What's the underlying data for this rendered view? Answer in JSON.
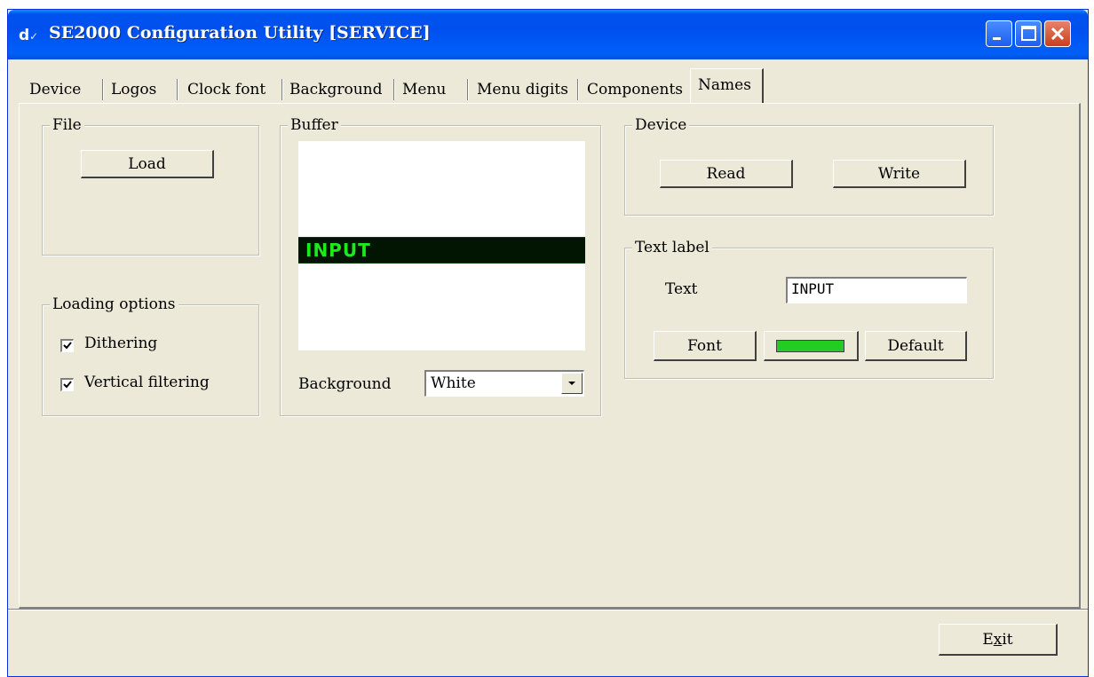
{
  "window": {
    "title": "SE2000 Configuration Utility [SERVICE]",
    "icon_text": "d",
    "icon_tick": "✓"
  },
  "tabs": [
    {
      "label": "Device"
    },
    {
      "label": "Logos"
    },
    {
      "label": "Clock font"
    },
    {
      "label": "Background"
    },
    {
      "label": "Menu"
    },
    {
      "label": "Menu digits"
    },
    {
      "label": "Components"
    },
    {
      "label": "Names",
      "active": true
    }
  ],
  "file_group": {
    "label": "File",
    "load_button": "Load"
  },
  "loading_options": {
    "label": "Loading options",
    "dithering": {
      "label": "Dithering",
      "checked": true
    },
    "vertical_filtering": {
      "label": "Vertical filtering",
      "checked": true
    }
  },
  "buffer": {
    "label": "Buffer",
    "preview_text": "INPUT",
    "preview_text_color": "#1ee81e",
    "background_label": "Background",
    "background_value": "White"
  },
  "device_group": {
    "label": "Device",
    "read_button": "Read",
    "write_button": "Write"
  },
  "text_label_group": {
    "label": "Text label",
    "text_label": "Text",
    "text_value": "INPUT",
    "font_button": "Font",
    "color_swatch": "#22cc22",
    "default_button": "Default"
  },
  "footer": {
    "exit_button_prefix": "E",
    "exit_button_mnemonic": "x",
    "exit_button_suffix": "it"
  }
}
